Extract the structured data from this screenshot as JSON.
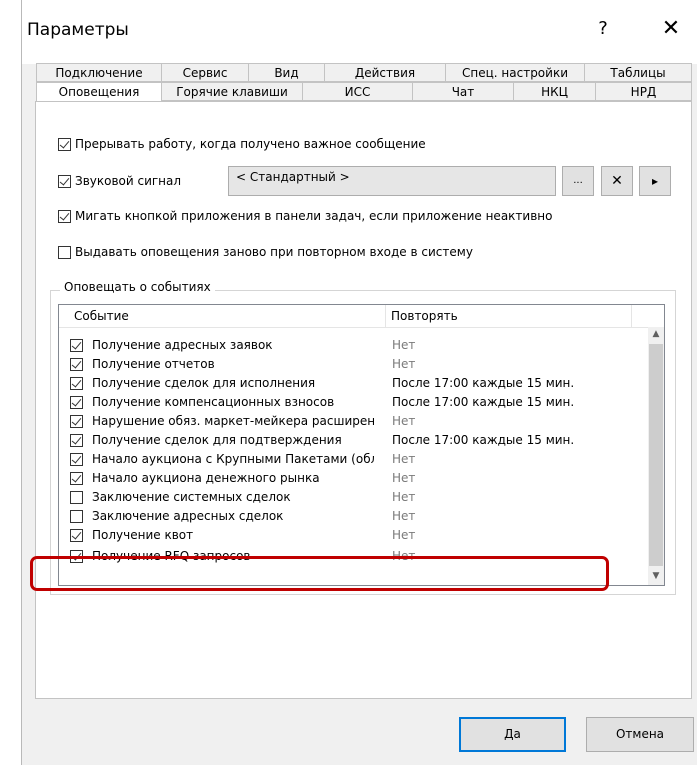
{
  "window": {
    "title": "Параметры",
    "help_label": "?",
    "close_label": "✕"
  },
  "tabs_row1": [
    "Подключение",
    "Сервис",
    "Вид",
    "Действия",
    "Спец. настройки",
    "Таблицы"
  ],
  "tabs_row2": [
    "Оповещения",
    "Горячие клавиши",
    "ИСС",
    "Чат",
    "НКЦ",
    "НРД"
  ],
  "active_tab": "Оповещения",
  "options": {
    "interrupt": {
      "label": "Прерывать работу, когда получено важное сообщение",
      "checked": true
    },
    "sound": {
      "label": "Звуковой сигнал",
      "checked": true,
      "value": "< Стандартный >"
    },
    "flash": {
      "label": "Мигать кнопкой приложения в панели задач, если приложение неактивно",
      "checked": true
    },
    "reissue": {
      "label": "Выдавать оповещения заново при повторном входе в систему",
      "checked": false
    }
  },
  "sound_buttons": {
    "browse": "...",
    "clear": "✕",
    "play": "▸"
  },
  "events_group": {
    "label": "Оповещать о событиях",
    "columns": [
      "Событие",
      "Повторять"
    ],
    "rows": [
      {
        "checked": true,
        "event": "Получение адресных заявок",
        "repeat": "Нет"
      },
      {
        "checked": true,
        "event": "Получение отчетов",
        "repeat": "Нет"
      },
      {
        "checked": true,
        "event": "Получение сделок для исполнения",
        "repeat": "После 17:00 каждые 15 мин."
      },
      {
        "checked": true,
        "event": "Получение компенсационных взносов",
        "repeat": "После 17:00 каждые 15 мин."
      },
      {
        "checked": true,
        "event": "Нарушение обяз. маркет-мейкера расширен...",
        "repeat": "Нет"
      },
      {
        "checked": true,
        "event": "Получение сделок для подтверждения",
        "repeat": "После 17:00 каждые 15 мин."
      },
      {
        "checked": true,
        "event": "Начало аукциона с Крупными Пакетами (обл...",
        "repeat": "Нет"
      },
      {
        "checked": true,
        "event": "Начало аукциона денежного рынка",
        "repeat": "Нет"
      },
      {
        "checked": false,
        "event": "Заключение системных сделок",
        "repeat": "Нет"
      },
      {
        "checked": false,
        "event": "Заключение адресных сделок",
        "repeat": "Нет"
      },
      {
        "checked": true,
        "event": "Получение квот",
        "repeat": "Нет"
      },
      {
        "checked": true,
        "event": "Получение RFQ запросов",
        "repeat": "Нет"
      }
    ]
  },
  "buttons": {
    "ok": "Да",
    "cancel": "Отмена"
  },
  "colors": {
    "highlight": "#c00000",
    "default_button_border": "#0078d7"
  }
}
